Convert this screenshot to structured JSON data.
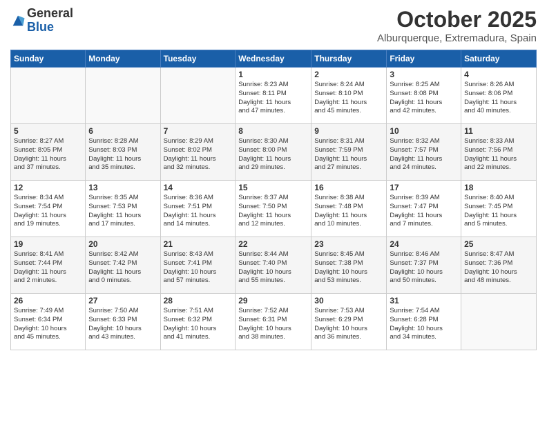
{
  "logo": {
    "general": "General",
    "blue": "Blue"
  },
  "header": {
    "title": "October 2025",
    "location": "Alburquerque, Extremadura, Spain"
  },
  "days": [
    "Sunday",
    "Monday",
    "Tuesday",
    "Wednesday",
    "Thursday",
    "Friday",
    "Saturday"
  ],
  "weeks": [
    [
      {
        "day": "",
        "info": ""
      },
      {
        "day": "",
        "info": ""
      },
      {
        "day": "",
        "info": ""
      },
      {
        "day": "1",
        "info": "Sunrise: 8:23 AM\nSunset: 8:11 PM\nDaylight: 11 hours\nand 47 minutes."
      },
      {
        "day": "2",
        "info": "Sunrise: 8:24 AM\nSunset: 8:10 PM\nDaylight: 11 hours\nand 45 minutes."
      },
      {
        "day": "3",
        "info": "Sunrise: 8:25 AM\nSunset: 8:08 PM\nDaylight: 11 hours\nand 42 minutes."
      },
      {
        "day": "4",
        "info": "Sunrise: 8:26 AM\nSunset: 8:06 PM\nDaylight: 11 hours\nand 40 minutes."
      }
    ],
    [
      {
        "day": "5",
        "info": "Sunrise: 8:27 AM\nSunset: 8:05 PM\nDaylight: 11 hours\nand 37 minutes."
      },
      {
        "day": "6",
        "info": "Sunrise: 8:28 AM\nSunset: 8:03 PM\nDaylight: 11 hours\nand 35 minutes."
      },
      {
        "day": "7",
        "info": "Sunrise: 8:29 AM\nSunset: 8:02 PM\nDaylight: 11 hours\nand 32 minutes."
      },
      {
        "day": "8",
        "info": "Sunrise: 8:30 AM\nSunset: 8:00 PM\nDaylight: 11 hours\nand 29 minutes."
      },
      {
        "day": "9",
        "info": "Sunrise: 8:31 AM\nSunset: 7:59 PM\nDaylight: 11 hours\nand 27 minutes."
      },
      {
        "day": "10",
        "info": "Sunrise: 8:32 AM\nSunset: 7:57 PM\nDaylight: 11 hours\nand 24 minutes."
      },
      {
        "day": "11",
        "info": "Sunrise: 8:33 AM\nSunset: 7:56 PM\nDaylight: 11 hours\nand 22 minutes."
      }
    ],
    [
      {
        "day": "12",
        "info": "Sunrise: 8:34 AM\nSunset: 7:54 PM\nDaylight: 11 hours\nand 19 minutes."
      },
      {
        "day": "13",
        "info": "Sunrise: 8:35 AM\nSunset: 7:53 PM\nDaylight: 11 hours\nand 17 minutes."
      },
      {
        "day": "14",
        "info": "Sunrise: 8:36 AM\nSunset: 7:51 PM\nDaylight: 11 hours\nand 14 minutes."
      },
      {
        "day": "15",
        "info": "Sunrise: 8:37 AM\nSunset: 7:50 PM\nDaylight: 11 hours\nand 12 minutes."
      },
      {
        "day": "16",
        "info": "Sunrise: 8:38 AM\nSunset: 7:48 PM\nDaylight: 11 hours\nand 10 minutes."
      },
      {
        "day": "17",
        "info": "Sunrise: 8:39 AM\nSunset: 7:47 PM\nDaylight: 11 hours\nand 7 minutes."
      },
      {
        "day": "18",
        "info": "Sunrise: 8:40 AM\nSunset: 7:45 PM\nDaylight: 11 hours\nand 5 minutes."
      }
    ],
    [
      {
        "day": "19",
        "info": "Sunrise: 8:41 AM\nSunset: 7:44 PM\nDaylight: 11 hours\nand 2 minutes."
      },
      {
        "day": "20",
        "info": "Sunrise: 8:42 AM\nSunset: 7:42 PM\nDaylight: 11 hours\nand 0 minutes."
      },
      {
        "day": "21",
        "info": "Sunrise: 8:43 AM\nSunset: 7:41 PM\nDaylight: 10 hours\nand 57 minutes."
      },
      {
        "day": "22",
        "info": "Sunrise: 8:44 AM\nSunset: 7:40 PM\nDaylight: 10 hours\nand 55 minutes."
      },
      {
        "day": "23",
        "info": "Sunrise: 8:45 AM\nSunset: 7:38 PM\nDaylight: 10 hours\nand 53 minutes."
      },
      {
        "day": "24",
        "info": "Sunrise: 8:46 AM\nSunset: 7:37 PM\nDaylight: 10 hours\nand 50 minutes."
      },
      {
        "day": "25",
        "info": "Sunrise: 8:47 AM\nSunset: 7:36 PM\nDaylight: 10 hours\nand 48 minutes."
      }
    ],
    [
      {
        "day": "26",
        "info": "Sunrise: 7:49 AM\nSunset: 6:34 PM\nDaylight: 10 hours\nand 45 minutes."
      },
      {
        "day": "27",
        "info": "Sunrise: 7:50 AM\nSunset: 6:33 PM\nDaylight: 10 hours\nand 43 minutes."
      },
      {
        "day": "28",
        "info": "Sunrise: 7:51 AM\nSunset: 6:32 PM\nDaylight: 10 hours\nand 41 minutes."
      },
      {
        "day": "29",
        "info": "Sunrise: 7:52 AM\nSunset: 6:31 PM\nDaylight: 10 hours\nand 38 minutes."
      },
      {
        "day": "30",
        "info": "Sunrise: 7:53 AM\nSunset: 6:29 PM\nDaylight: 10 hours\nand 36 minutes."
      },
      {
        "day": "31",
        "info": "Sunrise: 7:54 AM\nSunset: 6:28 PM\nDaylight: 10 hours\nand 34 minutes."
      },
      {
        "day": "",
        "info": ""
      }
    ]
  ]
}
